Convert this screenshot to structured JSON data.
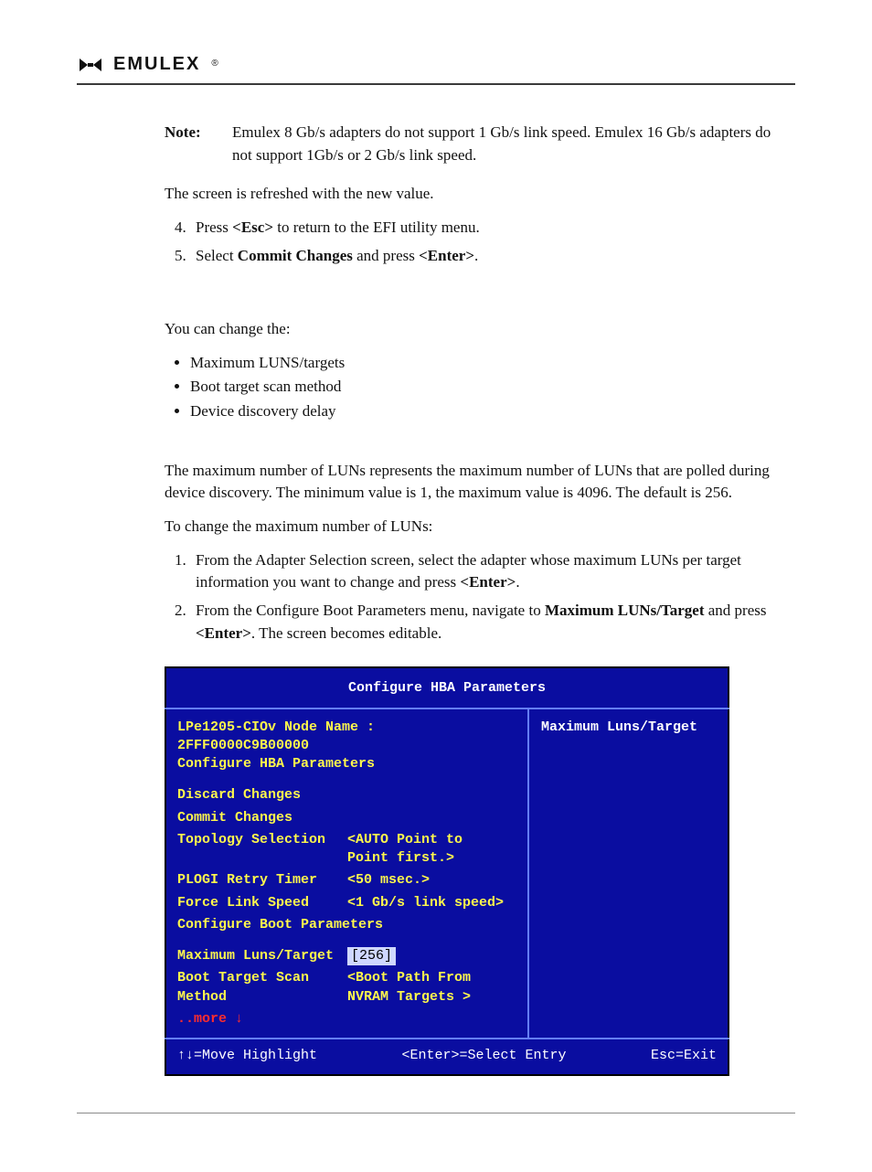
{
  "brand": {
    "name": "EMULEX",
    "registered": "®"
  },
  "note": {
    "label": "Note:",
    "text": "Emulex 8 Gb/s adapters do not support 1 Gb/s link speed. Emulex 16 Gb/s adapters do not support 1Gb/s or 2 Gb/s link speed."
  },
  "refresh_line": "The screen is refreshed with the new value.",
  "steps_a": {
    "start": 4,
    "items": [
      {
        "pre": "Press ",
        "b1": "<Esc>",
        "post": " to return to the EFI utility menu."
      },
      {
        "pre": "Select ",
        "b1": "Commit Changes",
        "mid": " and press ",
        "b2": "<Enter>",
        "post": "."
      }
    ]
  },
  "change_intro": "You can change the:",
  "change_list": [
    "Maximum LUNS/targets",
    "Boot target scan method",
    "Device discovery delay"
  ],
  "luns_para": "The maximum number of LUNs represents the maximum number of LUNs that are polled during device discovery. The minimum value is 1, the maximum value is 4096. The default is 256.",
  "to_change": "To change the maximum number of LUNs:",
  "steps_b": [
    {
      "pre": "From the Adapter Selection screen, select the adapter whose maximum LUNs per target information you want to change and press ",
      "b1": "<Enter>",
      "post": "."
    },
    {
      "pre": "From the Configure Boot Parameters menu, navigate to ",
      "b1": "Maximum LUNs/Target",
      "mid": " and press ",
      "b2": "<Enter>",
      "post": ". The screen becomes editable."
    }
  ],
  "bios": {
    "title": "Configure HBA Parameters",
    "node_line": "LPe1205-CIOv Node Name : 2FFF0000C9B00000",
    "subtitle": "Configure HBA Parameters",
    "right_help": "Maximum Luns/Target",
    "items": {
      "discard": "Discard Changes",
      "commit": "Commit  Changes",
      "topology_label": "Topology Selection",
      "topology_value": "<AUTO Point to Point first.>",
      "plogi_label": "PLOGI Retry Timer",
      "plogi_value": "<50 msec.>",
      "fls_label": "Force Link Speed",
      "fls_value": "<1 Gb/s link speed>",
      "cbp": "Configure Boot Parameters",
      "maxluns_label": "Maximum Luns/Target",
      "maxluns_value": "[256]",
      "btsm_label": "Boot Target Scan Method",
      "btsm_value": "<Boot Path From NVRAM Targets  >",
      "more": "..more ↓"
    },
    "footer": {
      "left": "↑↓=Move Highlight",
      "center": "<Enter>=Select Entry",
      "right": "Esc=Exit"
    }
  }
}
